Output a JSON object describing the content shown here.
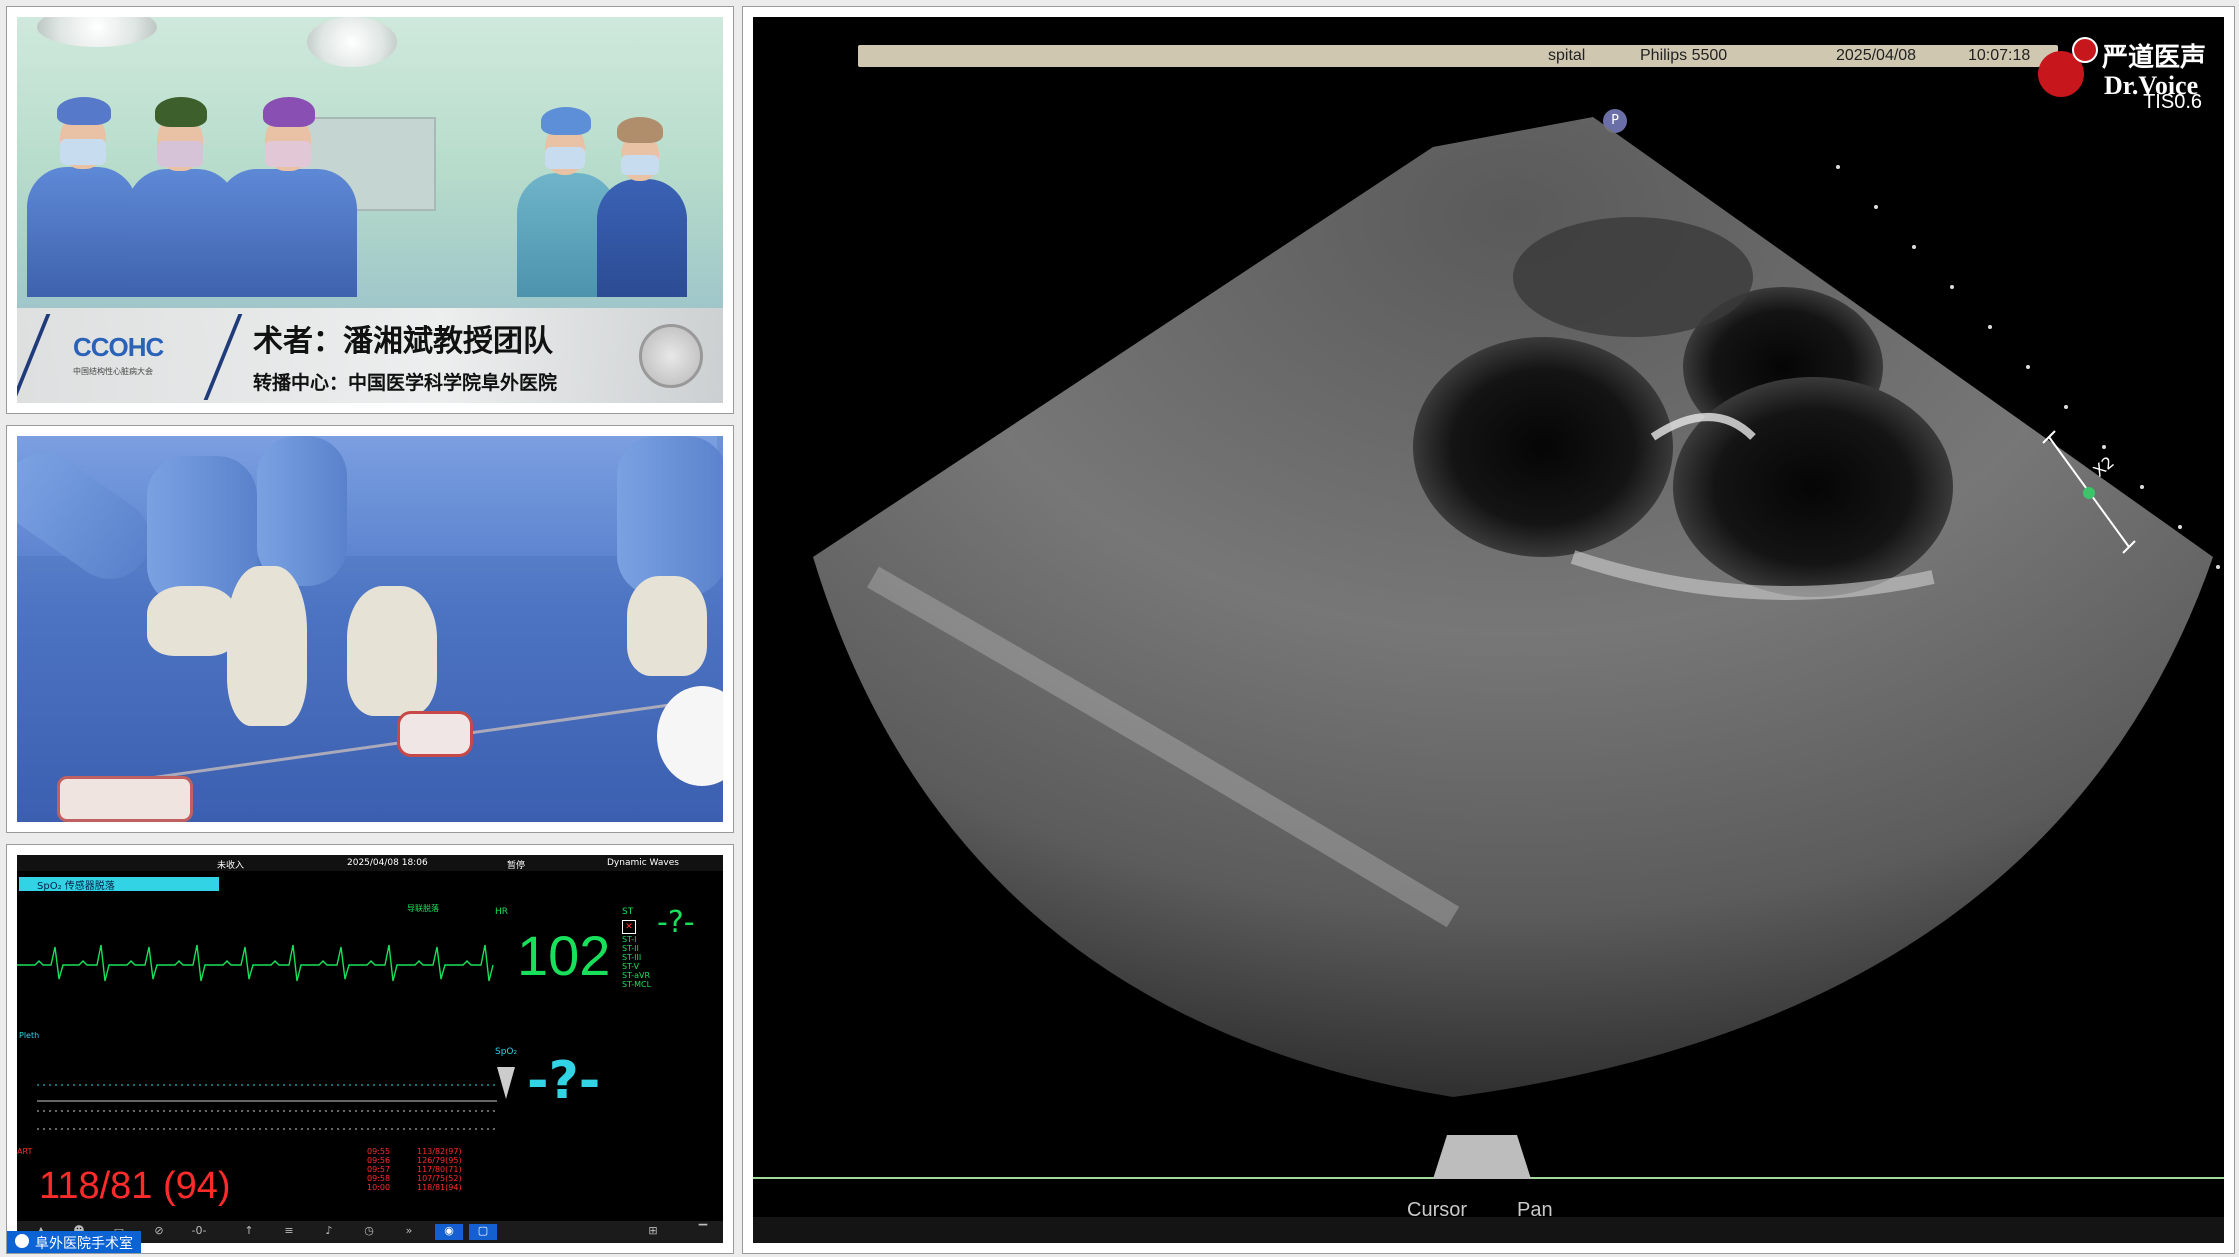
{
  "team_panel": {
    "logo": "CCOHC",
    "logo_sub": "中国结构性心脏病大会",
    "surgeon": "术者：潘湘斌教授团队",
    "center": "转播中心：中国医学科学院阜外医院"
  },
  "monitor": {
    "top_left": "未收入",
    "datetime": "2025/04/08  18:06",
    "top_mid": "暂停",
    "top_right": "Dynamic Waves",
    "alarm": "SpO₂ 传感器脱落",
    "lead_info": "导联脱落",
    "hr_label": "HR",
    "hr": "102",
    "st_label": "ST",
    "st_value": "-?-",
    "st_items": [
      "ST-I",
      "ST-II",
      "ST-III",
      "ST-V",
      "ST-aVR",
      "ST-MCL"
    ],
    "spo2_label": "SpO₂",
    "spo2": "-?-",
    "pleth_label": "Pleth",
    "bp_label": "ART",
    "bp": "118/81 (94)",
    "nibp_times": [
      "09:55",
      "09:56",
      "09:57",
      "09:58",
      "10:00"
    ],
    "nibp_values": [
      "113/82(97)",
      "126/79(95)",
      "117/80(71)",
      "107/75(52)",
      "118/81(94)"
    ],
    "toolbar_icons": [
      "alarm-icon",
      "user-icon",
      "bed-icon",
      "zero-icon",
      "nibp-icon",
      "list-icon",
      "mic-icon",
      "timer-icon",
      "forward-icon",
      "camera-icon",
      "screen-icon",
      "report-icon",
      "minimize-icon"
    ]
  },
  "user_chip": "阜外医院手术室",
  "echo": {
    "hospital": "spital",
    "machine": "Philips 5500",
    "date": "2025/04/08",
    "time": "10:07:18",
    "brand_cn": "严道医声",
    "brand_en": "Dr.Voice",
    "tis": "TIS0.6",
    "p_badge": "P",
    "x2": "X2",
    "cursor": "Cursor",
    "pan": "Pan"
  }
}
